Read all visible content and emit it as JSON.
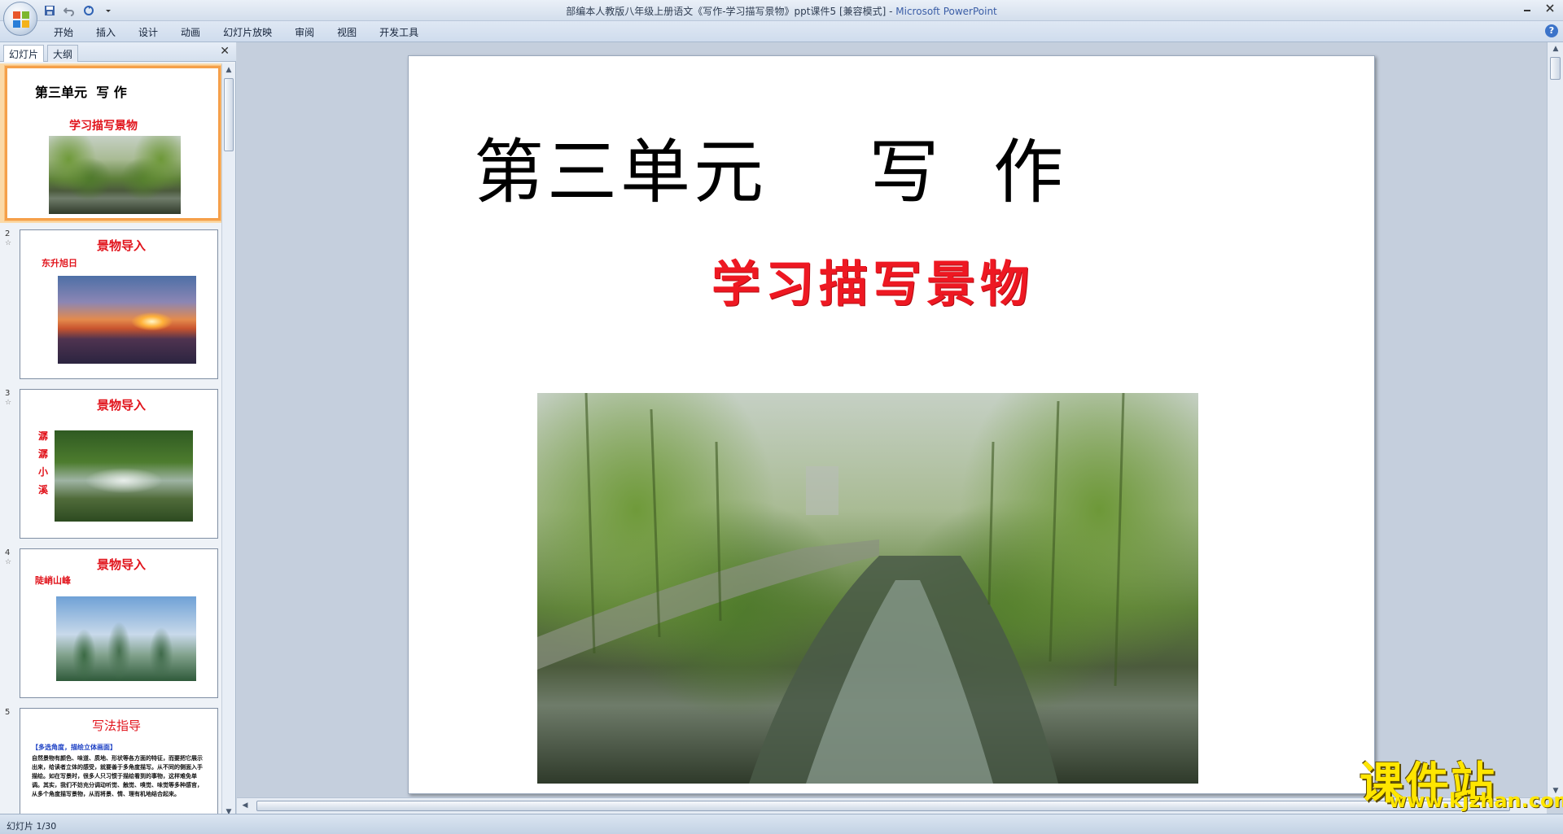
{
  "window": {
    "title_prefix": "部编本人教版八年级上册语文《写作-学习描写景物》ppt课件5 [兼容模式] - ",
    "app_name": "Microsoft PowerPoint"
  },
  "ribbon": {
    "tabs": [
      "开始",
      "插入",
      "设计",
      "动画",
      "幻灯片放映",
      "审阅",
      "视图",
      "开发工具"
    ]
  },
  "panel": {
    "tab_slides": "幻灯片",
    "tab_outline": "大纲",
    "close_glyph": "✕",
    "thumbnails": [
      {
        "num": "1",
        "title": "第三单元  写 作",
        "subtitle": "学习描写景物"
      },
      {
        "num": "2",
        "title": "景物导入",
        "caption": "东升旭日"
      },
      {
        "num": "3",
        "title": "景物导入",
        "caption": "潺潺小溪"
      },
      {
        "num": "4",
        "title": "景物导入",
        "caption": "陡峭山峰"
      },
      {
        "num": "5",
        "title": "写法指导",
        "bullet1": "【多选角度，描绘立体画面】",
        "bullet2": "自然景物有颜色、味道、质地、形状等各方面的特征，而要把它展示出来，给读者立体的感受，就要善于多角度描写。从不同的侧面入手描绘。如在写景时，很多人只习惯于描绘看到的事物，这样难免单调。其实，我们不妨充分调动听觉、触觉、嗅觉、味觉等多种感官，从多个角度描写景物，从而将景、情、理有机地结合起来。"
      }
    ]
  },
  "slide": {
    "title": "第三单元    写  作",
    "subtitle": "学习描写景物"
  },
  "status": {
    "text": "幻灯片 1/30"
  },
  "watermark": {
    "text": "课件站",
    "url": "www.kjzhan.com"
  }
}
